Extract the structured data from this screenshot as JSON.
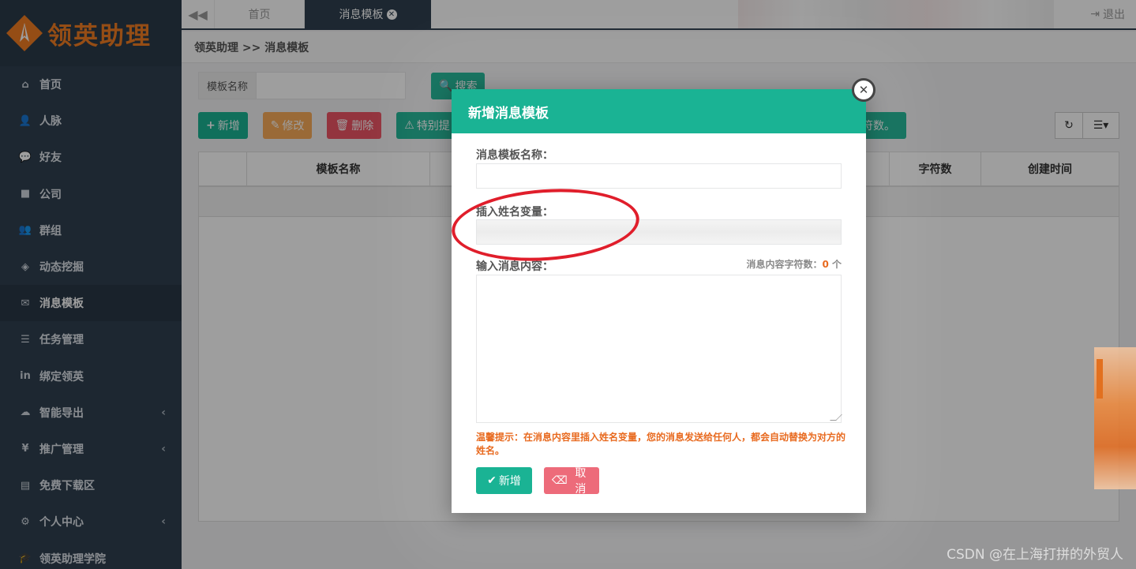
{
  "app": {
    "logo_text": "领英助理"
  },
  "sidebar": {
    "items": [
      {
        "label": "首页",
        "icon": "home-icon",
        "glyph": "⌂"
      },
      {
        "label": "人脉",
        "icon": "user-plus-icon",
        "glyph": "👤"
      },
      {
        "label": "好友",
        "icon": "chat-icon",
        "glyph": "💬"
      },
      {
        "label": "公司",
        "icon": "briefcase-icon",
        "glyph": "■"
      },
      {
        "label": "群组",
        "icon": "group-icon",
        "glyph": "👥"
      },
      {
        "label": "动态挖掘",
        "icon": "codepen-icon",
        "glyph": "◈"
      },
      {
        "label": "消息模板",
        "icon": "envelope-icon",
        "glyph": "✉",
        "active": true
      },
      {
        "label": "任务管理",
        "icon": "tasks-icon",
        "glyph": "☰"
      },
      {
        "label": "绑定领英",
        "icon": "linkedin-icon",
        "glyph": "in"
      },
      {
        "label": "智能导出",
        "icon": "cloud-download-icon",
        "glyph": "☁",
        "caret": true
      },
      {
        "label": "推广管理",
        "icon": "yen-icon",
        "glyph": "¥",
        "caret": true
      },
      {
        "label": "免费下载区",
        "icon": "file-icon",
        "glyph": "▤"
      },
      {
        "label": "个人中心",
        "icon": "gear-icon",
        "glyph": "⚙",
        "caret": true
      },
      {
        "label": "领英助理学院",
        "icon": "graduation-cap-icon",
        "glyph": "🎓"
      }
    ]
  },
  "topbar": {
    "tabs": [
      {
        "label": "首页"
      },
      {
        "label": "消息模板"
      }
    ],
    "logout_label": "退出"
  },
  "breadcrumb": {
    "text": "领英助理 >> 消息模板"
  },
  "search": {
    "label": "模板名称",
    "value": "",
    "button_label": "搜索"
  },
  "toolbar": {
    "add_label": "新增",
    "edit_label": "修改",
    "delete_label": "删除",
    "special_label": "特别提",
    "special_tail": "符数。"
  },
  "table": {
    "headers": [
      "",
      "模板名称",
      "",
      "字符数",
      "创建时间"
    ]
  },
  "modal": {
    "title": "新增消息模板",
    "name_label": "消息模板名称：",
    "name_value": "",
    "insert_label": "插入姓名变量：",
    "content_label": "输入消息内容：",
    "counter_prefix": "消息内容字符数：",
    "counter_value": "0",
    "counter_unit": " 个",
    "hint": "温馨提示：在消息内容里插入姓名变量，您的消息发送给任何人，都会自动替换为对方的姓名。",
    "submit_label": "新增",
    "cancel_label": "取消"
  },
  "watermark": "CSDN @在上海打拼的外贸人",
  "colors": {
    "primary": "#1ab394",
    "sidebar": "#2f4050",
    "accent_orange": "#f07d22",
    "danger": "#ed5565",
    "warning": "#f8ac59",
    "annotation_red": "#e01e2b"
  }
}
